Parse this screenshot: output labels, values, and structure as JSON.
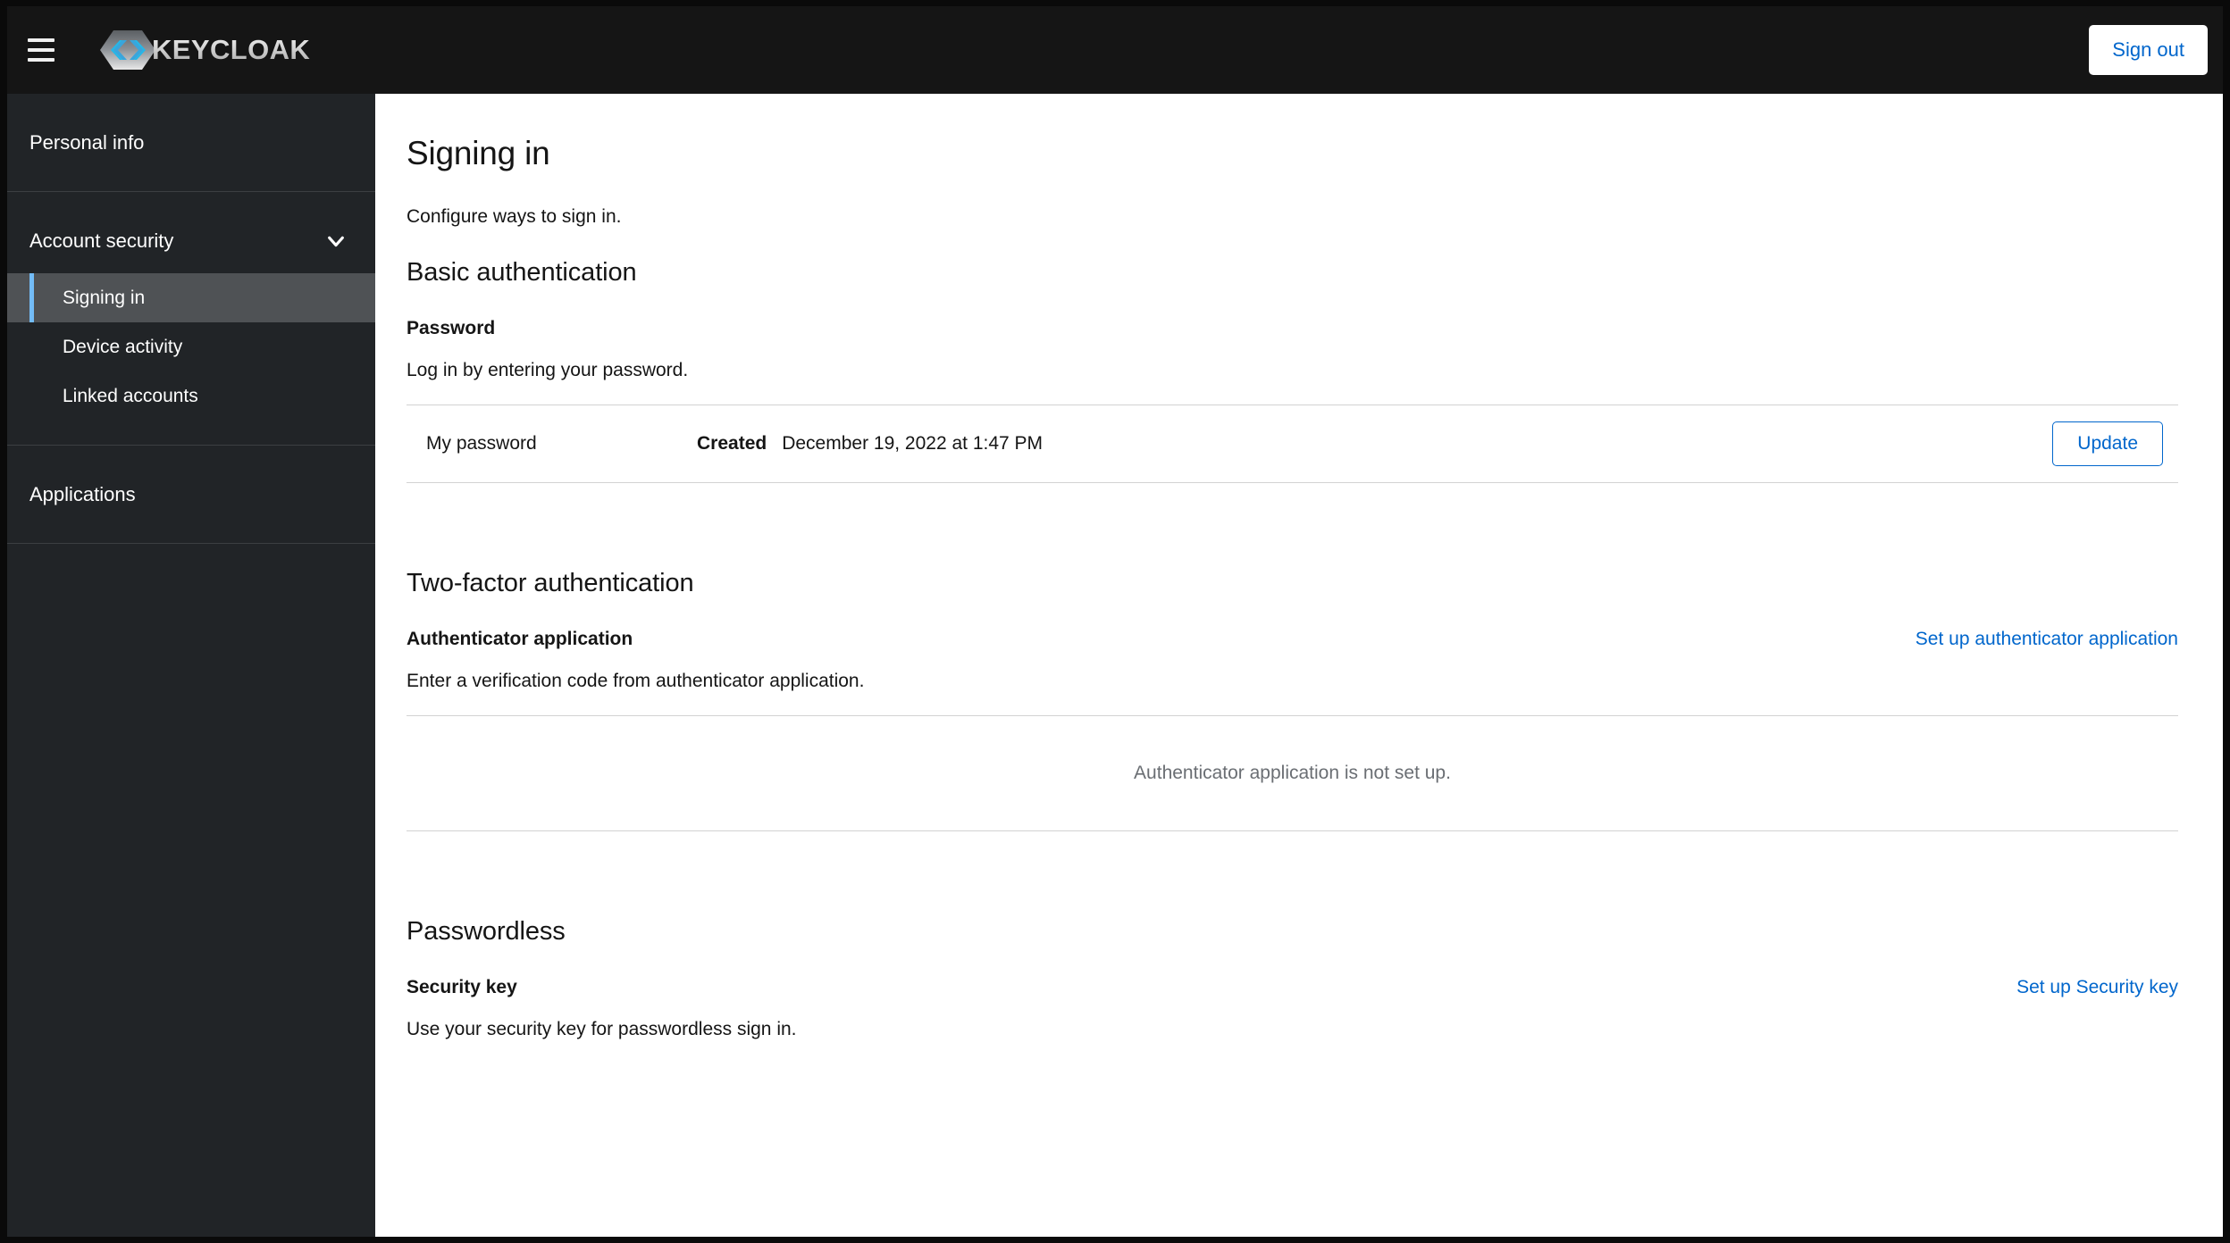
{
  "masthead": {
    "hamburger_icon": "hamburger-menu-icon",
    "brand_name": "KEYCLOAK",
    "brand_logo_icon": "keycloak-logo-icon",
    "signout_label": "Sign out"
  },
  "sidebar": {
    "personal_info": "Personal info",
    "account_security": "Account security",
    "account_security_chevron_icon": "chevron-down-icon",
    "sub_items": [
      {
        "label": "Signing in",
        "active": true
      },
      {
        "label": "Device activity",
        "active": false
      },
      {
        "label": "Linked accounts",
        "active": false
      }
    ],
    "applications": "Applications"
  },
  "main": {
    "page_title": "Signing in",
    "page_subtitle": "Configure ways to sign in.",
    "basic_auth": {
      "section_title": "Basic authentication",
      "sub_head": "Password",
      "description": "Log in by entering your password.",
      "credential": {
        "label": "My password",
        "meta_key": "Created",
        "meta_value": "December 19, 2022 at 1:47 PM",
        "action_label": "Update"
      }
    },
    "two_factor": {
      "section_title": "Two-factor authentication",
      "sub_head": "Authenticator application",
      "setup_link": "Set up authenticator application",
      "description": "Enter a verification code from authenticator application.",
      "empty_state": "Authenticator application is not set up."
    },
    "passwordless": {
      "section_title": "Passwordless",
      "sub_head": "Security key",
      "setup_link": "Set up Security key",
      "description": "Use your security key for passwordless sign in."
    }
  },
  "colors": {
    "masthead_bg": "#151515",
    "sidebar_bg": "#212427",
    "active_accent": "#73bcf7",
    "link_blue": "#0066cc",
    "muted_text": "#6a6e73"
  }
}
